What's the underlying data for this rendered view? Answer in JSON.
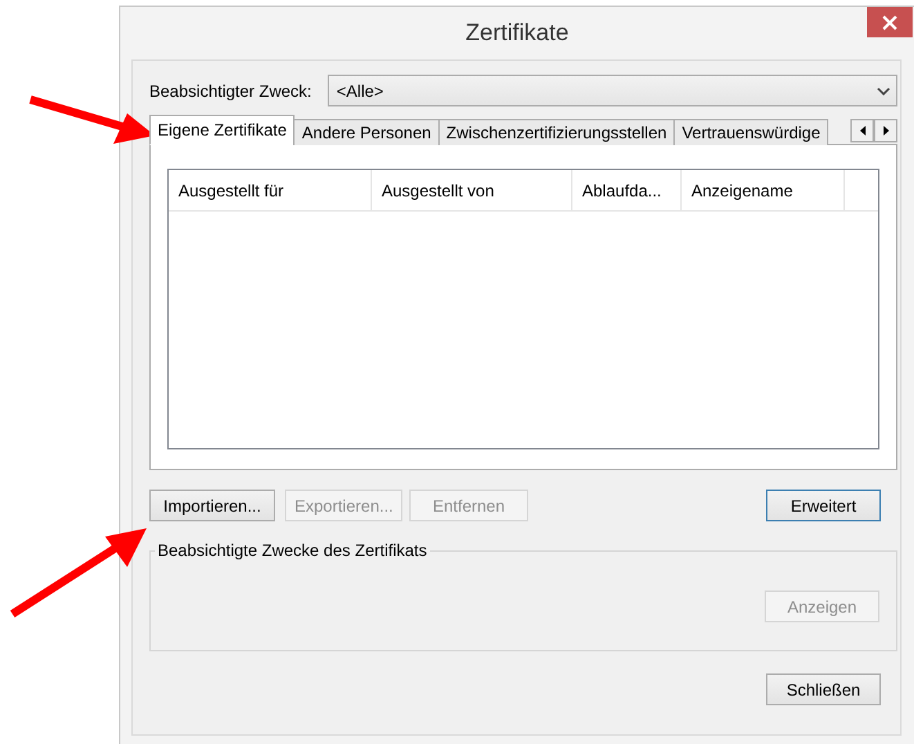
{
  "window": {
    "title": "Zertifikate"
  },
  "purpose": {
    "label": "Beabsichtigter Zweck:",
    "value": "<Alle>"
  },
  "tabs": [
    {
      "label": "Eigene Zertifikate",
      "selected": true
    },
    {
      "label": "Andere Personen",
      "selected": false
    },
    {
      "label": "Zwischenzertifizierungsstellen",
      "selected": false
    },
    {
      "label": "Vertrauenswürdige",
      "selected": false
    }
  ],
  "table": {
    "columns": [
      "Ausgestellt für",
      "Ausgestellt von",
      "Ablaufda...",
      "Anzeigename"
    ]
  },
  "buttons": [
    {
      "label": "Importieren...",
      "disabled": false,
      "default": false
    },
    {
      "label": "Exportieren...",
      "disabled": true,
      "default": false
    },
    {
      "label": "Entfernen",
      "disabled": true,
      "default": false
    },
    {
      "label": "Erweitert",
      "disabled": false,
      "default": true
    }
  ],
  "group": {
    "title": "Beabsichtigte Zwecke des Zertifikats",
    "button": {
      "label": "Anzeigen",
      "disabled": true,
      "default": false
    }
  },
  "close_button": {
    "label": "Schließen",
    "disabled": false,
    "default": false
  }
}
